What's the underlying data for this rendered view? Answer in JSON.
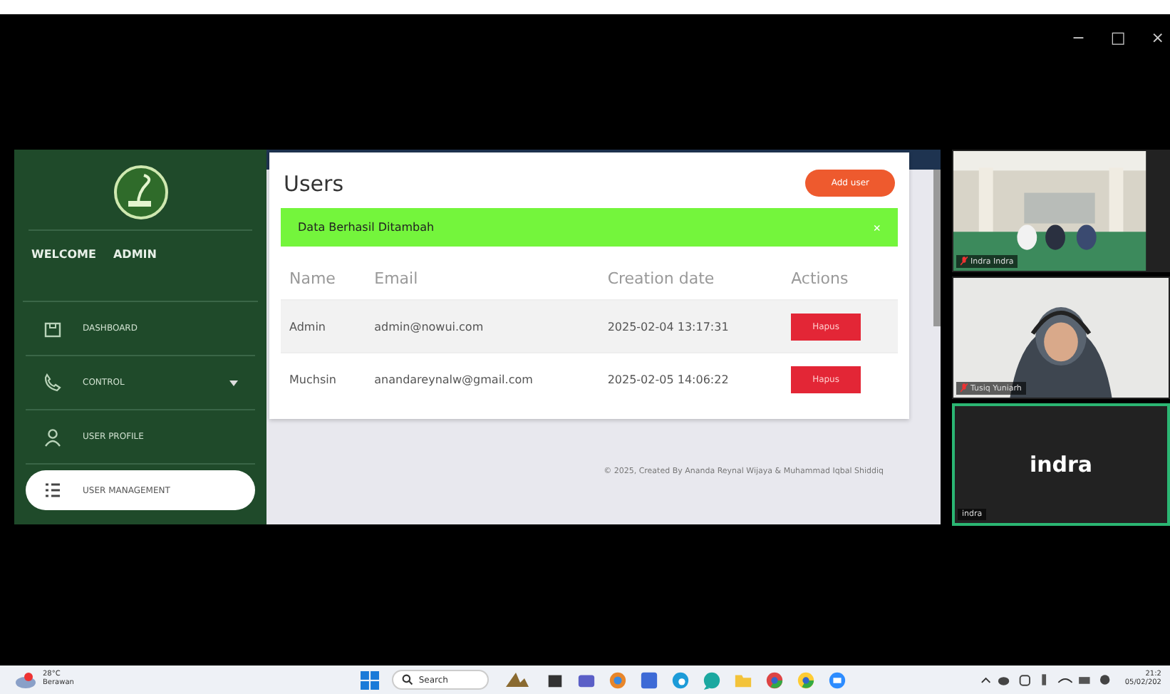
{
  "window_controls": [
    "−",
    "□",
    "×"
  ],
  "sidebar": {
    "welcome": "WELCOME",
    "user": "ADMIN",
    "items": [
      {
        "label": "DASHBOARD",
        "selected": false,
        "dropdown": false
      },
      {
        "label": "CONTROL",
        "selected": false,
        "dropdown": true
      },
      {
        "label": "USER PROFILE",
        "selected": false,
        "dropdown": false
      },
      {
        "label": "USER MANAGEMENT",
        "selected": true,
        "dropdown": false
      }
    ]
  },
  "page": {
    "title": "Users",
    "add_button": "Add user",
    "alert": {
      "text": "Data Berhasil Ditambah",
      "close": "×"
    },
    "table": {
      "columns": [
        "Name",
        "Email",
        "Creation date",
        "Actions"
      ],
      "rows": [
        {
          "name": "Admin",
          "email": "admin@nowui.com",
          "created": "2025-02-04 13:17:31",
          "action": "Hapus",
          "selected": true
        },
        {
          "name": "Muchsin",
          "email": "anandareynalw@gmail.com",
          "created": "2025-02-05 14:06:22",
          "action": "Hapus",
          "selected": false
        }
      ]
    },
    "footer": "© 2025, Created By Ananda Reynal Wijaya & Muhammad Iqbal Shiddiq"
  },
  "participants": [
    {
      "kind": "room",
      "name": "Indra Indra",
      "muted": true,
      "speaking": false
    },
    {
      "kind": "person",
      "name": "Tusiq Yuniarh",
      "muted": true,
      "speaking": false
    },
    {
      "kind": "avatar",
      "display": "indra",
      "name": "indra",
      "muted": false,
      "speaking": true
    }
  ],
  "taskbar": {
    "weather": {
      "temp": "28°C",
      "condition": "Berawan"
    },
    "search": "Search",
    "time": "21:2",
    "date": "05/02/202"
  }
}
